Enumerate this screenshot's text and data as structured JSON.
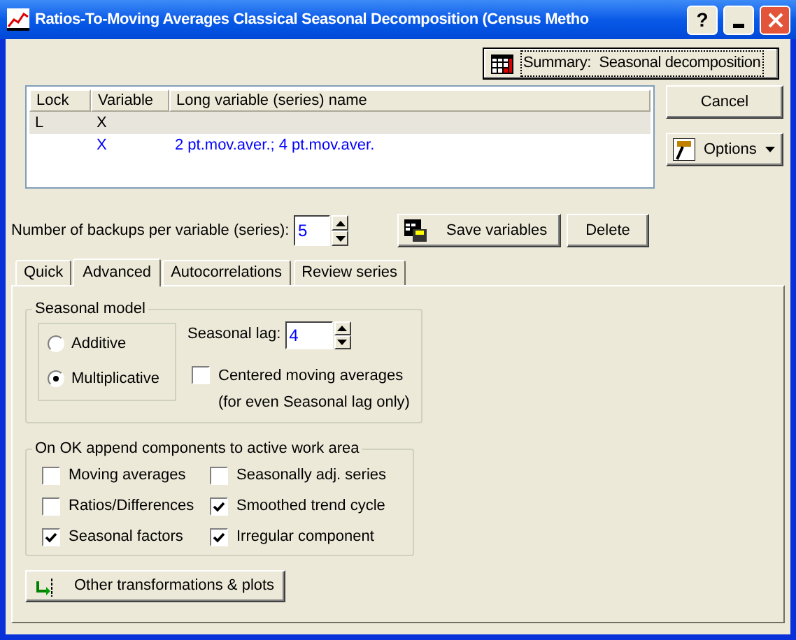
{
  "window": {
    "title": "Ratios-To-Moving Averages Classical Seasonal Decomposition (Census Metho",
    "help_button": "?"
  },
  "summary_button": "Summary:  Seasonal decomposition",
  "variable_list": {
    "columns": [
      "Lock",
      "Variable",
      "Long variable (series) name"
    ],
    "rows": [
      {
        "lock": "L",
        "variable": "X",
        "selected": true
      },
      {
        "variable": "X",
        "long_name": "2 pt.mov.aver.; 4 pt.mov.aver.",
        "selected": false
      }
    ]
  },
  "cancel_button": "Cancel",
  "options_button": "Options",
  "backups": {
    "label": "Number of backups per variable (series):",
    "value": "5"
  },
  "save_button": "Save variables",
  "delete_button": "Delete",
  "tabs": [
    {
      "label": "Quick",
      "selected": false
    },
    {
      "label": "Advanced",
      "selected": true
    },
    {
      "label": "Autocorrelations",
      "selected": false
    },
    {
      "label": "Review series",
      "selected": false
    }
  ],
  "seasonal_model": {
    "title": "Seasonal model",
    "options": [
      {
        "label": "Additive",
        "selected": false
      },
      {
        "label": "Multiplicative",
        "selected": true
      }
    ],
    "lag_label": "Seasonal lag:",
    "lag_value": "4",
    "centered": {
      "label": "Centered moving averages",
      "note": "(for even Seasonal lag only)",
      "checked": false
    }
  },
  "components": {
    "title": "On OK append components to active work area",
    "items": [
      {
        "label": "Moving averages",
        "checked": false
      },
      {
        "label": "Seasonally adj. series",
        "checked": false
      },
      {
        "label": "Ratios/Differences",
        "checked": false
      },
      {
        "label": "Smoothed trend cycle",
        "checked": true
      },
      {
        "label": "Seasonal factors",
        "checked": true
      },
      {
        "label": "Irregular component",
        "checked": true
      }
    ]
  },
  "other_button": "Other transformations & plots"
}
